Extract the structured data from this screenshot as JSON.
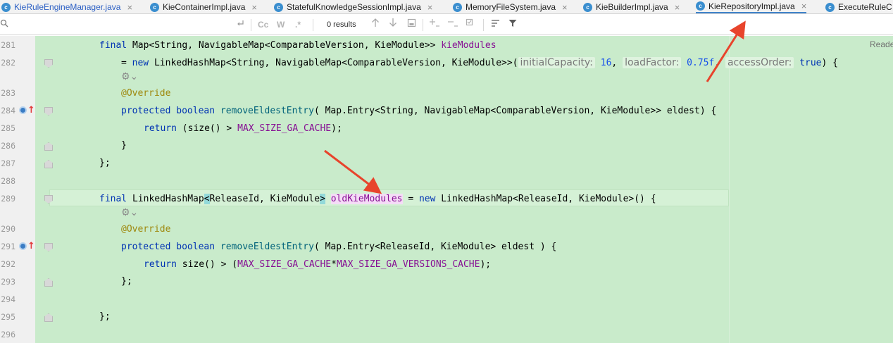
{
  "tabs": [
    {
      "label": "KieRuleEngineManager.java"
    },
    {
      "label": "KieContainerImpl.java"
    },
    {
      "label": "StatefulKnowledgeSessionImpl.java"
    },
    {
      "label": "MemoryFileSystem.java"
    },
    {
      "label": "KieBuilderImpl.java"
    },
    {
      "label": "KieRepositoryImpl.java"
    },
    {
      "label": "ExecuteRuleC"
    }
  ],
  "tab_close_glyph": "×",
  "class_icon_letter": "c",
  "search": {
    "placeholder": "",
    "match_case_label": "Cc",
    "words_label": "W",
    "regex_label": ".*",
    "results_text": "0 results"
  },
  "editor": {
    "reader_mode_label": "Reade",
    "line_numbers": [
      "281",
      "282",
      "283",
      "284",
      "285",
      "286",
      "287",
      "288",
      "289",
      "290",
      "291",
      "292",
      "293",
      "294",
      "295",
      "296"
    ],
    "hints": {
      "initial_capacity": "initialCapacity:",
      "load_factor": "loadFactor:",
      "access_order": "accessOrder:"
    },
    "lines": {
      "l281_a": "final ",
      "l281_b": "Map<String, NavigableMap<ComparableVersion, KieModule>> ",
      "l281_c": "kieModules",
      "l282_a": "= ",
      "l282_b": "new ",
      "l282_c": "LinkedHashMap<String, NavigableMap<ComparableVersion, KieModule>>(",
      "l282_d": "16",
      "l282_e": ", ",
      "l282_f": "0.75f",
      "l282_g": ", ",
      "l282_h": "true",
      "l282_i": ") {",
      "l283": "@Override",
      "l284_a": "protected boolean ",
      "l284_b": "removeEldestEntry",
      "l284_c": "( Map.Entry<String, NavigableMap<ComparableVersion, KieModule>> eldest) {",
      "l285_a": "return ",
      "l285_b": "(size() > ",
      "l285_c": "MAX_SIZE_GA_CACHE",
      "l285_d": ");",
      "l286": "}",
      "l287": "};",
      "l289_a": "final ",
      "l289_b": "LinkedHashMap",
      "l289_c": "<",
      "l289_d": "ReleaseId, KieModule",
      "l289_e": ">",
      "l289_f": " ",
      "l289_g": "oldKieModules",
      "l289_h": " = ",
      "l289_i": "new ",
      "l289_j": "LinkedHashMap<ReleaseId, KieModule>() {",
      "l290": "@Override",
      "l291_a": "protected boolean ",
      "l291_b": "removeEldestEntry",
      "l291_c": "( Map.Entry<ReleaseId, KieModule> eldest ) {",
      "l292_a": "return ",
      "l292_b": "size() > (",
      "l292_c": "MAX_SIZE_GA_CACHE",
      "l292_d": "*",
      "l292_e": "MAX_SIZE_GA_VERSIONS_CACHE",
      "l292_f": ");",
      "l293": "};",
      "l295": "};"
    }
  },
  "colors": {
    "editor_bg": "#c9ebcb",
    "keyword": "#0033b3",
    "method": "#00627a",
    "annotation": "#9e880d",
    "constant": "#871094",
    "arrow": "#e8442c",
    "active_tab_underline": "#4083c9"
  },
  "icons": [
    "class-icon",
    "search-icon",
    "newline-icon",
    "arrow-up-icon",
    "arrow-down-icon",
    "filter-icon",
    "override-icon",
    "gear-icon"
  ]
}
